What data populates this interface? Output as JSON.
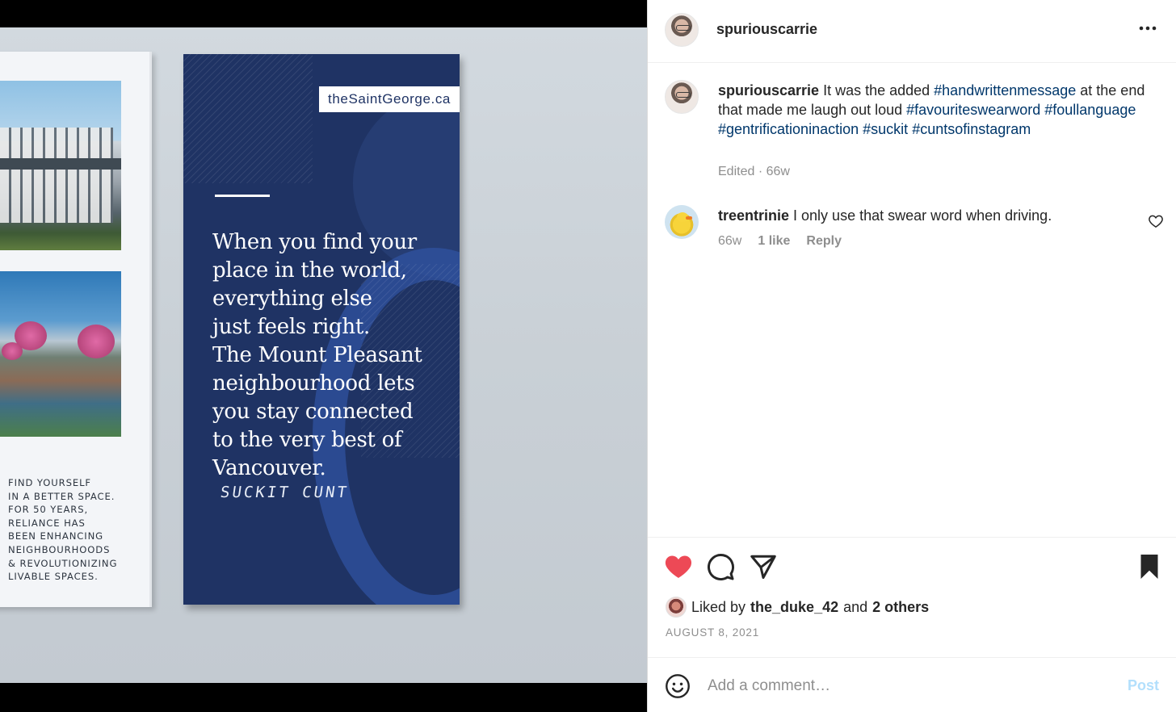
{
  "photo": {
    "sign_url": "theSaintGeorge.ca",
    "sign_quote_lines": [
      "When you find your",
      "place in the world,",
      "everything else",
      "just feels right.",
      "The Mount Pleasant",
      "neighbourhood lets",
      "you stay connected",
      "to the very best of",
      "Vancouver."
    ],
    "sign_graffiti": "SUCKIT CUNT",
    "left_panel_lines": [
      "FIND YOURSELF",
      "IN A BETTER SPACE.",
      "FOR 50 YEARS,",
      "RELIANCE HAS",
      "BEEN ENHANCING",
      "NEIGHBOURHOODS",
      "& REVOLUTIONIZING",
      "LIVABLE SPACES."
    ]
  },
  "header": {
    "username": "spuriouscarrie",
    "more_icon": "more-horizontal-icon"
  },
  "caption": {
    "username": "spuriouscarrie",
    "text_part1": " It was the added ",
    "tag1": "#handwrittenmessage",
    "text_part2": " at the end that made me laugh out loud ",
    "tag2": "#favouriteswearword",
    "tag3": "#foullanguage",
    "tag4": "#gentrificationinaction",
    "tag5": "#suckit",
    "tag6": "#cuntsofinstagram",
    "edited": "Edited",
    "separator": " · ",
    "age": "66w"
  },
  "comments": [
    {
      "username": "treentrinie",
      "text": " I only use that swear word when driving.",
      "age": "66w",
      "likes": "1 like",
      "reply": "Reply"
    }
  ],
  "actions": {
    "liked_by_prefix": "Liked by",
    "liked_by_user": "the_duke_42",
    "and": "and",
    "others": "2 others",
    "date": "AUGUST 8, 2021",
    "like_color": "#ed4956"
  },
  "comment_bar": {
    "placeholder": "Add a comment…",
    "post_label": "Post",
    "post_color": "#b2dffc"
  }
}
